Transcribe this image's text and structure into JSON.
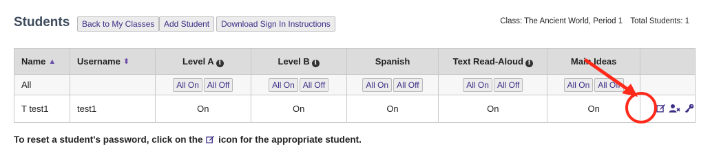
{
  "header": {
    "title": "Students",
    "buttons": {
      "back": "Back to My Classes",
      "add": "Add Student",
      "download": "Download Sign In Instructions"
    },
    "class_label": "Class: The Ancient World, Period 1",
    "total_label": "Total Students: 1"
  },
  "table": {
    "columns": {
      "name": "Name",
      "username": "Username",
      "level_a": "Level A",
      "level_b": "Level B",
      "spanish": "Spanish",
      "tts": "Text Read-Aloud",
      "main_ideas": "Main Ideas"
    },
    "all_row": {
      "label": "All",
      "all_on": "All On",
      "all_off": "All Off"
    },
    "students": [
      {
        "name": "T test1",
        "username": "test1",
        "level_a": "On",
        "level_b": "On",
        "spanish": "On",
        "tts": "On",
        "main_ideas": "On"
      }
    ]
  },
  "help": {
    "before": "To reset a student's password, click on the",
    "after": "icon for the appropriate student."
  },
  "icons": {
    "sort_name": "sort-asc-icon",
    "sort_username": "sort-both-icon",
    "info": "info-circle-icon",
    "edit": "edit-icon",
    "remove_user": "remove-user-icon",
    "key": "key-icon"
  },
  "colors": {
    "accent_purple": "#3b2e86",
    "annotation_red": "#ff2a1a",
    "header_bg": "#dcdcdc"
  }
}
